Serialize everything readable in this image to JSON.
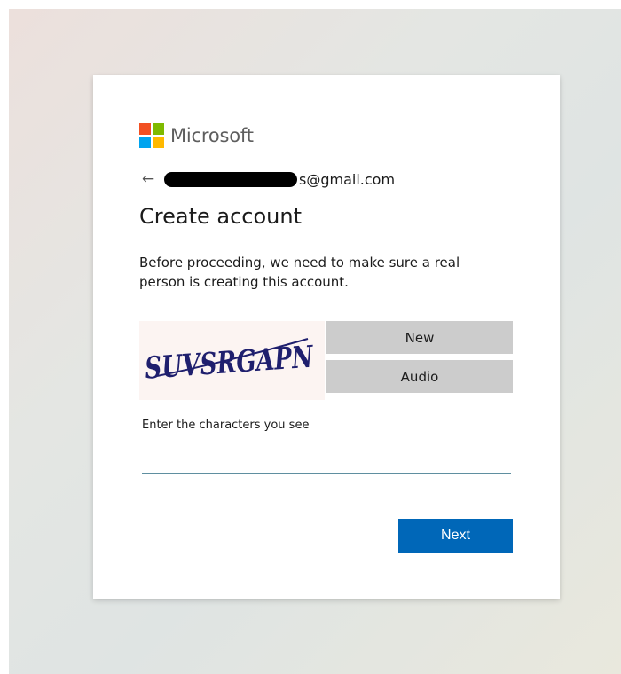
{
  "brand": {
    "name": "Microsoft",
    "logo_colors": [
      "#f25022",
      "#7fba00",
      "#00a4ef",
      "#ffb900"
    ]
  },
  "identity": {
    "back_icon": "arrow-left-icon",
    "email_visible": "s@gmail.com"
  },
  "page": {
    "title": "Create account",
    "description": "Before proceeding, we need to make sure a real person is creating this account."
  },
  "captcha": {
    "text": "SUVSRGAPN",
    "new_label": "New",
    "audio_label": "Audio",
    "input_label": "Enter the characters you see",
    "input_value": "",
    "input_placeholder": ""
  },
  "actions": {
    "next_label": "Next"
  },
  "colors": {
    "accent": "#0067b8",
    "secondary_button": "#cccccc",
    "captcha_ink": "#1f1f6e"
  }
}
